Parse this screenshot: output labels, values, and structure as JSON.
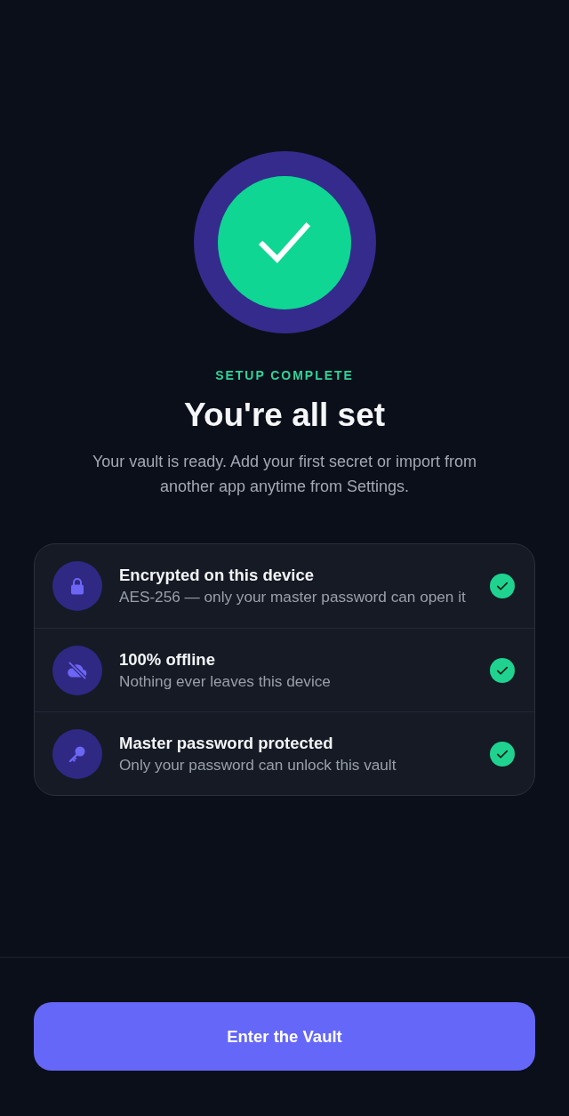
{
  "hero": {
    "label": "SETUP COMPLETE",
    "title": "You're all set",
    "subtitle": "Your vault is ready. Add your first secret or import from another app anytime from Settings."
  },
  "features": [
    {
      "kind": "lock",
      "title": "Encrypted on this device",
      "description": "AES-256 — only your master password can open it",
      "checked": true
    },
    {
      "kind": "offline",
      "title": "100% offline",
      "description": "Nothing ever leaves this device",
      "checked": true
    },
    {
      "kind": "key",
      "title": "Master password protected",
      "description": "Only your password can unlock this vault",
      "checked": true
    }
  ],
  "footer": {
    "button": "Enter the Vault"
  }
}
